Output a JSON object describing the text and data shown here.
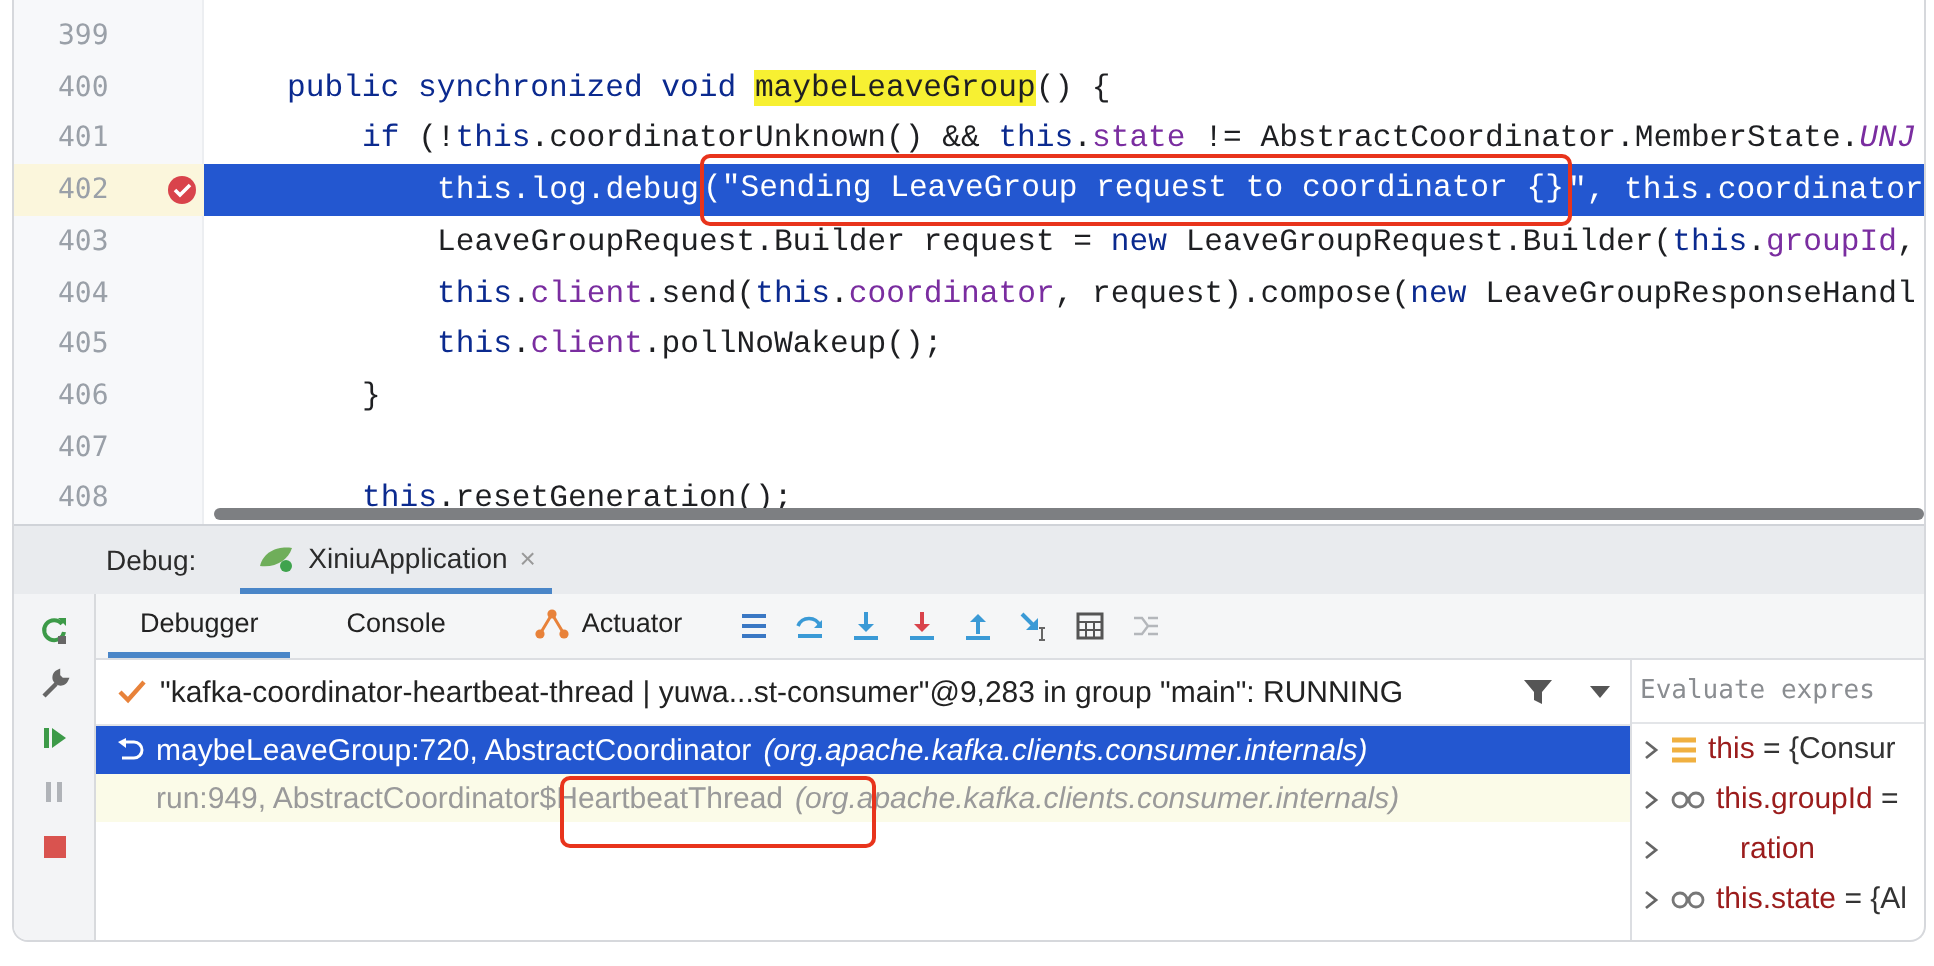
{
  "editor": {
    "lines": [
      {
        "number": "399",
        "current": false
      },
      {
        "number": "400",
        "current": false,
        "tokens": [
          {
            "kind": "keyword",
            "text": "public synchronized void "
          },
          {
            "kind": "highlight",
            "text": "maybeLeaveGroup"
          },
          {
            "kind": "plain",
            "text": "() {"
          }
        ],
        "children": [
          {
            "number": "401",
            "current": false,
            "tokens": [
              {
                "kind": "keyword",
                "text": "if"
              },
              {
                "kind": "plain",
                "text": " (!"
              },
              {
                "kind": "keyword",
                "text": "this"
              },
              {
                "kind": "plain",
                "text": ".coordinatorUnknown() && "
              },
              {
                "kind": "keyword",
                "text": "this"
              },
              {
                "kind": "plain",
                "text": "."
              },
              {
                "kind": "field",
                "text": "state"
              },
              {
                "kind": "plain",
                "text": " != AbstractCoordinator.MemberState."
              },
              {
                "kind": "static",
                "text": "UNJ"
              }
            ],
            "children": [
              {
                "number": "402",
                "current": true,
                "tokens": [
                  {
                    "kind": "plain",
                    "text": "this.log.debug"
                  },
                  {
                    "kind": "plain",
                    "boxed": true,
                    "text": "(\"Sending LeaveGroup request to coordinator {}"
                  },
                  {
                    "kind": "plain",
                    "text": "\", this.coordinator"
                  }
                ]
              },
              {
                "number": "403",
                "current": false,
                "tokens": [
                  {
                    "kind": "plain",
                    "text": "LeaveGroupRequest.Builder request = "
                  },
                  {
                    "kind": "keyword",
                    "text": "new"
                  },
                  {
                    "kind": "plain",
                    "text": " LeaveGroupRequest.Builder("
                  },
                  {
                    "kind": "keyword",
                    "text": "this"
                  },
                  {
                    "kind": "plain",
                    "text": "."
                  },
                  {
                    "kind": "field",
                    "text": "groupId"
                  },
                  {
                    "kind": "plain",
                    "text": ","
                  }
                ]
              },
              {
                "number": "404",
                "current": false,
                "tokens": [
                  {
                    "kind": "keyword",
                    "text": "this"
                  },
                  {
                    "kind": "plain",
                    "text": "."
                  },
                  {
                    "kind": "field",
                    "text": "client"
                  },
                  {
                    "kind": "plain",
                    "text": ".send("
                  },
                  {
                    "kind": "keyword",
                    "text": "this"
                  },
                  {
                    "kind": "plain",
                    "text": "."
                  },
                  {
                    "kind": "field",
                    "text": "coordinator"
                  },
                  {
                    "kind": "plain",
                    "text": ", request).compose("
                  },
                  {
                    "kind": "keyword",
                    "text": "new"
                  },
                  {
                    "kind": "plain",
                    "text": " LeaveGroupResponseHandl"
                  }
                ]
              },
              {
                "number": "405",
                "current": false,
                "tokens": [
                  {
                    "kind": "keyword",
                    "text": "this"
                  },
                  {
                    "kind": "plain",
                    "text": "."
                  },
                  {
                    "kind": "field",
                    "text": "client"
                  },
                  {
                    "kind": "plain",
                    "text": ".pollNoWakeup();"
                  }
                ]
              }
            ]
          },
          {
            "number": "406",
            "current": false,
            "tokens": [
              {
                "kind": "plain",
                "text": "}"
              }
            ]
          },
          {
            "number": "407",
            "current": false
          },
          {
            "number": "408",
            "current": false,
            "tokens": [
              {
                "kind": "keyword",
                "text": "this"
              },
              {
                "kind": "plain",
                "text": ".resetGeneration();"
              }
            ]
          }
        ]
      }
    ]
  },
  "debug": {
    "label": "Debug:",
    "session_tab": {
      "label": "XiniuApplication",
      "close": "×"
    },
    "tabs": [
      {
        "label": "Debugger",
        "selected": true
      },
      {
        "label": "Console",
        "selected": false
      },
      {
        "label": "Actuator",
        "selected": false
      }
    ],
    "thread": "\"kafka-coordinator-heartbeat-thread | yuwa...st-consumer\"@9,283 in group \"main\": RUNNING",
    "frames": [
      {
        "method": "maybeLeaveGroup:720, AbstractCoordinator",
        "package": "(org.apache.kafka.clients.consumer.internals)",
        "selected": true
      },
      {
        "method": "run:949, AbstractCoordinator$HeartbeatThread",
        "package": "(org.apache.kafka.clients.consumer.internals)",
        "selected": false
      }
    ],
    "evaluate": {
      "placeholder": "Evaluate expres"
    },
    "variables": [
      {
        "kind": "object",
        "name": "this",
        "value": " = {Consur"
      },
      {
        "kind": "field",
        "name": "this.groupId",
        "value": " ="
      },
      {
        "kind": "hidden",
        "name": "ration"
      },
      {
        "kind": "field",
        "name": "this.state",
        "value": " = {Al"
      }
    ]
  }
}
